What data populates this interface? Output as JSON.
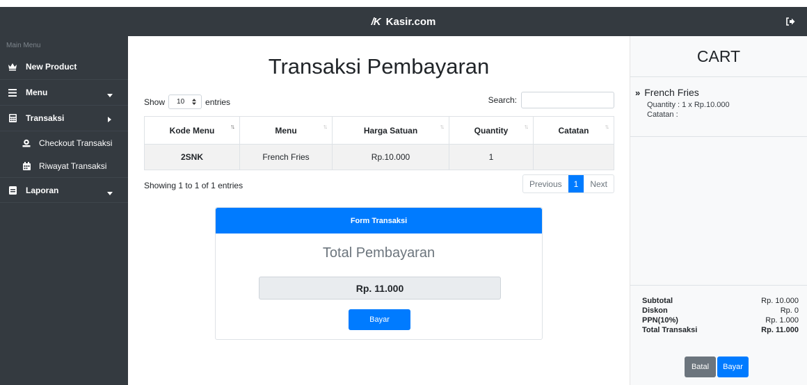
{
  "header": {
    "brand_logo": "/K",
    "brand_name": "Kasir.com"
  },
  "sidebar": {
    "heading": "Main Menu",
    "items": [
      {
        "label": "New Product"
      },
      {
        "label": "Menu"
      },
      {
        "label": "Transaksi"
      },
      {
        "label": "Laporan"
      }
    ],
    "sub_items": [
      {
        "label": "Checkout Transaksi"
      },
      {
        "label": "Riwayat Transaksi"
      }
    ]
  },
  "main": {
    "title": "Transaksi Pembayaran",
    "show_label": "Show",
    "entries_value": "10",
    "entries_label": "entries",
    "search_label": "Search:",
    "search_value": "",
    "table": {
      "headers": [
        "Kode Menu",
        "Menu",
        "Harga Satuan",
        "Quantity",
        "Catatan"
      ],
      "rows": [
        [
          "2SNK",
          "French Fries",
          "Rp.10.000",
          "1",
          ""
        ]
      ]
    },
    "info": "Showing 1 to 1 of 1 entries",
    "pager": {
      "previous": "Previous",
      "current": "1",
      "next": "Next"
    },
    "form": {
      "header": "Form Transaksi",
      "total_label": "Total Pembayaran",
      "total_value": "Rp. 11.000",
      "button": "Bayar"
    }
  },
  "cart": {
    "title": "CART",
    "item": {
      "name": "French Fries",
      "quantity_line": "Quantity : 1 x Rp.10.000",
      "note_line": "Catatan :"
    },
    "summary": [
      {
        "label": "Subtotal",
        "value": "Rp. 10.000"
      },
      {
        "label": "Diskon",
        "value": "Rp. 0"
      },
      {
        "label": "PPN(10%)",
        "value": "Rp. 1.000"
      },
      {
        "label": "Total Transaksi",
        "value": "Rp. 11.000"
      }
    ],
    "cancel_button": "Batal",
    "pay_button": "Bayar"
  },
  "colors": {
    "dark": "#343a40",
    "primary": "#007bff",
    "secondary": "#6c757d"
  }
}
